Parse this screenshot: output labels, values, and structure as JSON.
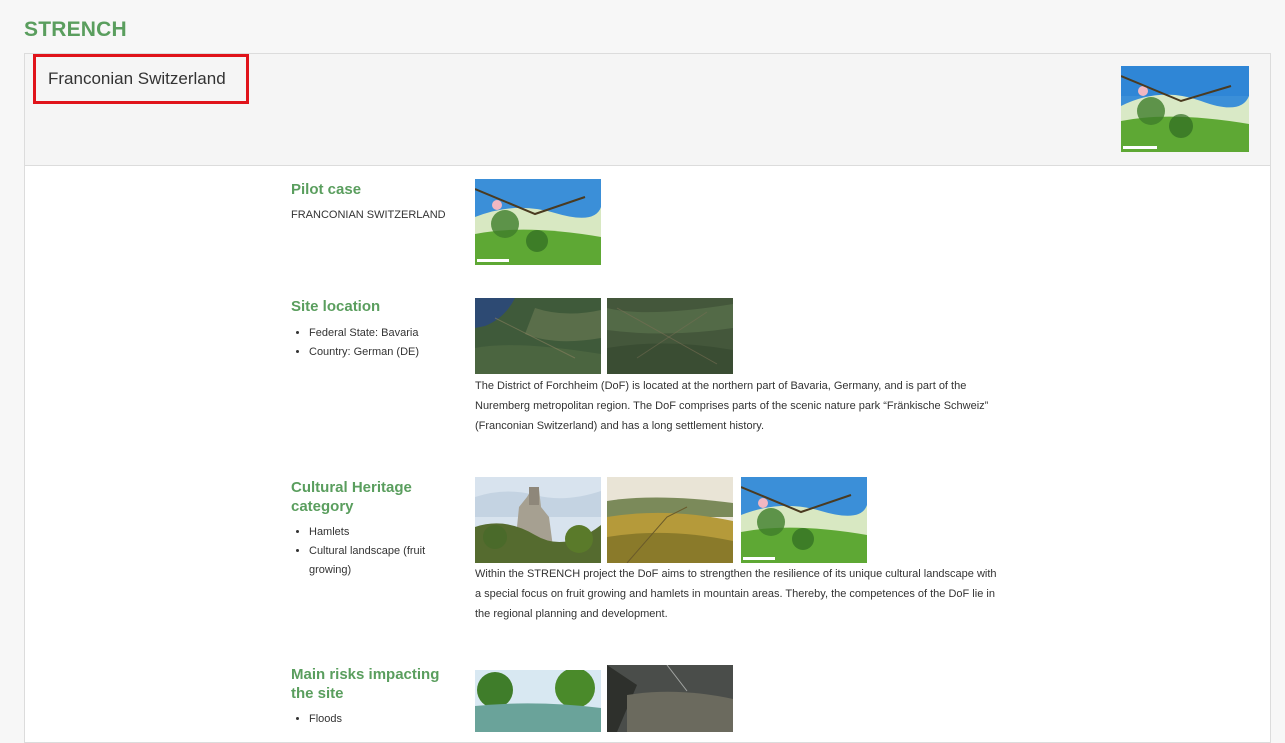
{
  "app": {
    "title": "STRENCH"
  },
  "header": {
    "site_title": "Franconian Switzerland"
  },
  "pilot": {
    "title": "Pilot case",
    "text": "FRANCONIAN SWITZERLAND"
  },
  "location": {
    "title": "Site location",
    "bullets": [
      "Federal State: Bavaria",
      "Country: German (DE)"
    ],
    "paragraph": "The District of Forchheim (DoF) is located at the northern part of Bavaria, Germany, and is part of the Nuremberg metropolitan region. The DoF comprises parts of the scenic nature park “Fränkische Schweiz” (Franconian Switzerland) and has a long settlement history."
  },
  "heritage": {
    "title": "Cultural Heritage category",
    "bullets": [
      "Hamlets",
      "Cultural landscape (fruit growing)"
    ],
    "paragraph": "Within the STRENCH project the DoF aims to strengthen the resilience of its unique cultural landscape with a special focus on fruit growing and hamlets in mountain areas. Thereby, the competences of the DoF lie in the regional planning and development."
  },
  "risks": {
    "title": "Main risks impacting the site",
    "bullets": [
      "Floods"
    ]
  }
}
